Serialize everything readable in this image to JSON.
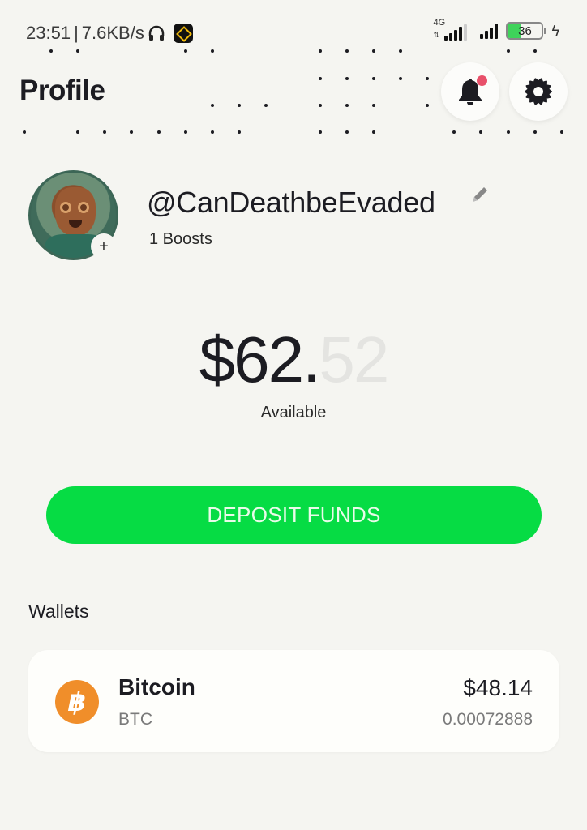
{
  "status_bar": {
    "time": "23:51",
    "separator": "|",
    "network_speed": "7.6KB/s",
    "network_type": "4G",
    "battery_level": "36",
    "battery_percent": 36,
    "charging": true,
    "icons": [
      "headphones-icon",
      "binance-icon",
      "signal-icon",
      "signal-icon",
      "battery-icon",
      "charging-bolt-icon"
    ]
  },
  "header": {
    "title": "Profile",
    "notifications": {
      "icon": "bell-icon",
      "has_unread": true,
      "badge_color": "#e8506a"
    },
    "settings": {
      "icon": "gear-icon"
    }
  },
  "profile": {
    "username": "@CanDeathbeEvaded",
    "boosts": "1 Boosts",
    "avatar_add_label": "+",
    "edit_icon": "pencil-icon"
  },
  "balance": {
    "whole": "$62.",
    "cents": "52",
    "label": "Available"
  },
  "deposit": {
    "label": "DEPOSIT FUNDS",
    "color": "#06dc44"
  },
  "wallets": {
    "title": "Wallets",
    "items": [
      {
        "name": "Bitcoin",
        "ticker": "BTC",
        "icon_glyph": "฿",
        "icon_color": "#f08e2a",
        "usd_value": "$48.14",
        "amount": "0.00072888"
      }
    ]
  }
}
